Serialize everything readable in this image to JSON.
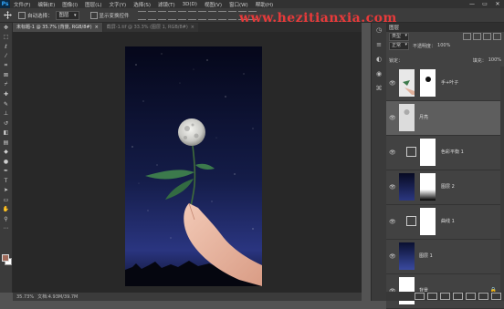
{
  "app": {
    "logo": "Ps"
  },
  "menu": [
    "文件(F)",
    "编辑(E)",
    "图像(I)",
    "图层(L)",
    "文字(Y)",
    "选择(S)",
    "滤镜(T)",
    "3D(D)",
    "视图(V)",
    "窗口(W)",
    "帮助(H)"
  ],
  "window_controls": [
    "—",
    "▭",
    "✕"
  ],
  "options": {
    "auto_select_label": "自动选择：",
    "auto_select_value": "图层",
    "show_transform_label": "显示变换控件"
  },
  "watermark": "www.hezitianxia.com",
  "tabs": [
    {
      "label": "未标题-1 @ 35.7% (背景, RGB/8#)",
      "active": true
    },
    {
      "label": "截屏-1.tif @ 33.3% (图层 1, RGB/8#)",
      "active": false
    }
  ],
  "status": {
    "zoom": "35.73%",
    "doc": "文档:4.93M/39.7M"
  },
  "layers_panel": {
    "title": "图层",
    "filter": "类型",
    "blend_mode": "正常",
    "opacity_label": "不透明度：",
    "opacity_value": "100%",
    "lock_label": "锁定：",
    "fill_label": "填充：",
    "fill_value": "100%",
    "layers": [
      {
        "name": "手+叶子",
        "visible": true,
        "type": "plant",
        "has_mask": true
      },
      {
        "name": "月亮",
        "visible": true,
        "type": "moon",
        "has_mask": false,
        "selected": true
      },
      {
        "name": "色彩平衡 1",
        "visible": true,
        "type": "adjust",
        "has_mask": true
      },
      {
        "name": "图层 2",
        "visible": true,
        "type": "sky",
        "has_mask": true
      },
      {
        "name": "曲线 1",
        "visible": true,
        "type": "adjust",
        "has_mask": true
      },
      {
        "name": "图层 1",
        "visible": true,
        "type": "sky",
        "has_mask": false
      },
      {
        "name": "背景",
        "visible": true,
        "type": "white",
        "has_mask": false,
        "locked": true
      }
    ]
  },
  "colors": {
    "foreground": "#a06a5a",
    "background": "#ffffff",
    "selected_layer": "#5e5e5e"
  }
}
